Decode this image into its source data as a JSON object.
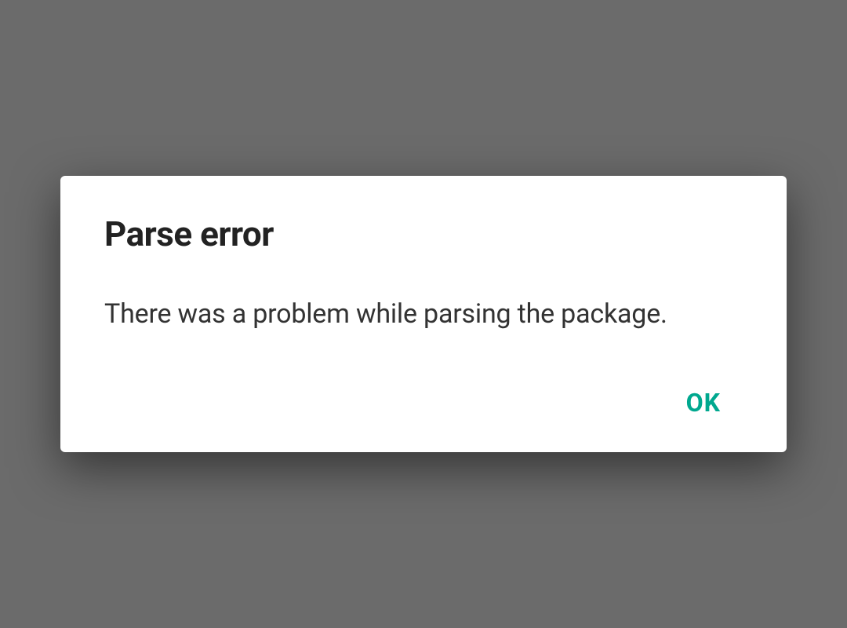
{
  "dialog": {
    "title": "Parse error",
    "message": "There was a problem while parsing the package.",
    "actions": {
      "ok_label": "OK"
    }
  }
}
